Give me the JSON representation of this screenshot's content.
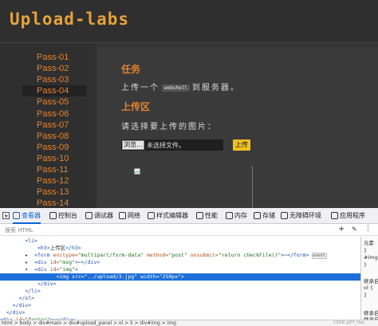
{
  "app": {
    "logo_text": "Upload-labs"
  },
  "sidebar": {
    "items": [
      {
        "label": "Pass-01"
      },
      {
        "label": "Pass-02"
      },
      {
        "label": "Pass-03"
      },
      {
        "label": "Pass-04"
      },
      {
        "label": "Pass-05"
      },
      {
        "label": "Pass-06"
      },
      {
        "label": "Pass-07"
      },
      {
        "label": "Pass-08"
      },
      {
        "label": "Pass-09"
      },
      {
        "label": "Pass-10"
      },
      {
        "label": "Pass-11"
      },
      {
        "label": "Pass-12"
      },
      {
        "label": "Pass-13"
      },
      {
        "label": "Pass-14"
      }
    ],
    "active_item": "Pass-04"
  },
  "main": {
    "task_heading": "任务",
    "task_text_before": "上传一个",
    "task_code": "webshell",
    "task_text_after": "到服务器。",
    "upload_heading": "上传区",
    "upload_prompt": "请选择要上传的图片：",
    "browse_label": "浏览...",
    "file_status": "未选择文件。",
    "upload_button": "上传"
  },
  "devtools": {
    "tabs": [
      {
        "label": "查看器",
        "icon": "inspector-icon"
      },
      {
        "label": "控制台",
        "icon": "console-icon"
      },
      {
        "label": "调试器",
        "icon": "debugger-icon"
      },
      {
        "label": "网络",
        "icon": "network-icon"
      },
      {
        "label": "样式编辑器",
        "icon": "style-editor-icon"
      },
      {
        "label": "性能",
        "icon": "performance-icon"
      },
      {
        "label": "内存",
        "icon": "memory-icon"
      },
      {
        "label": "存储",
        "icon": "storage-icon"
      },
      {
        "label": "无障碍环境",
        "icon": "accessibility-icon"
      },
      {
        "label": "应用程序",
        "icon": "application-icon"
      }
    ],
    "active_tab": "查看器",
    "search_placeholder": "搜索 HTML",
    "dom_lines": [
      {
        "indent": "    ",
        "parts": [
          [
            "tg",
            "<li>"
          ]
        ]
      },
      {
        "indent": "      ",
        "parts": [
          [
            "tg",
            "<h3>"
          ],
          [
            "tx",
            "上传区"
          ],
          [
            "tg",
            "</h3>"
          ]
        ]
      },
      {
        "indent": "    ▸ ",
        "parts": [
          [
            "tg",
            "<form "
          ],
          [
            "at",
            "enctype="
          ],
          [
            "av",
            "\"multipart/form-data\" "
          ],
          [
            "at",
            "method="
          ],
          [
            "av",
            "\"post\" "
          ],
          [
            "at",
            "onsubmit="
          ],
          [
            "av",
            "\"return checkFile()\""
          ],
          [
            "tg",
            ">"
          ],
          [
            "tx",
            "⋯"
          ],
          [
            "tg",
            "</form>"
          ]
        ],
        "event": "event"
      },
      {
        "indent": "    ▸ ",
        "parts": [
          [
            "tg",
            "<div "
          ],
          [
            "at",
            "id="
          ],
          [
            "av",
            "\"msg\""
          ],
          [
            "tg",
            ">"
          ],
          [
            "tx",
            "⋯"
          ],
          [
            "tg",
            "</div>"
          ]
        ]
      },
      {
        "indent": "    ▾ ",
        "parts": [
          [
            "tg",
            "<div "
          ],
          [
            "at",
            "id="
          ],
          [
            "av",
            "\"img\""
          ],
          [
            "tg",
            ">"
          ]
        ]
      },
      {
        "indent": "         ",
        "parts": [
          [
            "tg",
            "<img "
          ],
          [
            "at",
            "src="
          ],
          [
            "av",
            "\"../upload/3.jpg\" "
          ],
          [
            "at",
            "width="
          ],
          [
            "av",
            "\"250px\""
          ],
          [
            "tg",
            ">"
          ]
        ],
        "selected": true
      },
      {
        "indent": "      ",
        "parts": [
          [
            "tg",
            "</div>"
          ]
        ]
      },
      {
        "indent": "    ",
        "parts": [
          [
            "tg",
            "</li>"
          ]
        ]
      },
      {
        "indent": "   ",
        "parts": [
          [
            "tg",
            "</ol>"
          ]
        ]
      },
      {
        "indent": "  ",
        "parts": [
          [
            "tg",
            "</div>"
          ]
        ]
      },
      {
        "indent": " ",
        "parts": [
          [
            "tg",
            "</div>"
          ]
        ]
      },
      {
        "indent": "",
        "parts": [
          [
            "tg",
            "<div "
          ],
          [
            "at",
            "id="
          ],
          [
            "av",
            "\"footer\""
          ],
          [
            "tg",
            ">"
          ],
          [
            "tx",
            "⋯"
          ],
          [
            "tg",
            "</div>"
          ]
        ]
      }
    ],
    "rules_panel": [
      "元素",
      "}",
      "#img",
      "}",
      "继承自",
      "ol {",
      "}",
      "继承自",
      "继承自"
    ],
    "breadcrumb": "html > body > div#main > div#upload_panel > ol > li > div#img > img",
    "watermark": "CSDN @FY_Hao"
  }
}
